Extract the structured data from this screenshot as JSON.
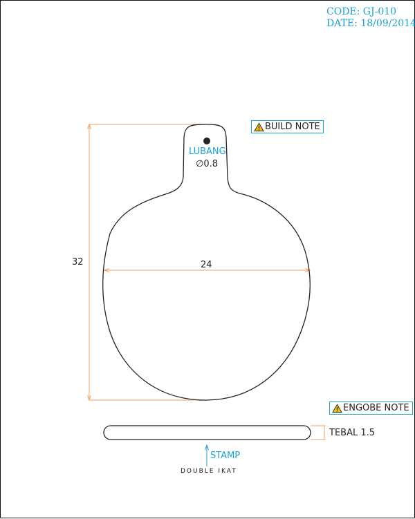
{
  "header": {
    "code": "CODE: GJ-010",
    "date": "DATE: 18/09/2014"
  },
  "notes": {
    "build_note": "BUILD NOTE",
    "engobe_note": "ENGOBE NOTE"
  },
  "hole": {
    "label": "LUBANG",
    "diameter": "∅0.8"
  },
  "dimensions": {
    "height": "32",
    "width": "24",
    "thickness": "TEBAL 1.5"
  },
  "stamp": {
    "label": "STAMP",
    "logo_text": "DOUBLE IKAT"
  },
  "colors": {
    "accent": "#1aa3d1",
    "dimension_line": "#f0a060",
    "outline": "#222222"
  },
  "icons": {
    "warning": "warning-triangle-icon",
    "arrow": "arrow-up-icon"
  }
}
